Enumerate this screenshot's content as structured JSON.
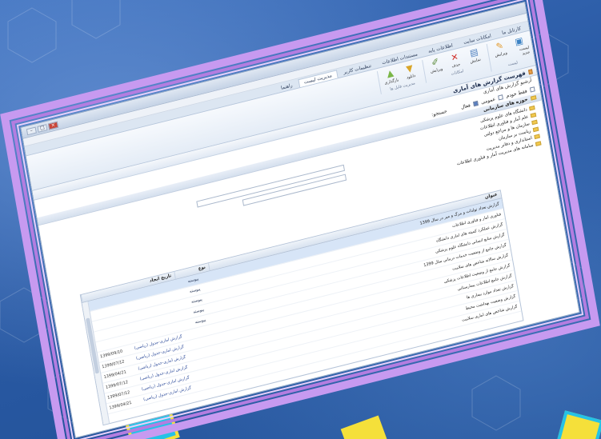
{
  "ribbon": {
    "tabs": [
      "کارتابل ما",
      "امکانات سایت",
      "اطلاعات پایه",
      "مستندات اطلاعات",
      "تنظیمات کاربر",
      "مدیریت لیست",
      "راهنما"
    ],
    "active_tab": "مدیریت لیست",
    "groups": [
      {
        "label": "لیست",
        "buttons": [
          "لیست جدید",
          "ویرایش"
        ]
      },
      {
        "label": "امکانات",
        "buttons": [
          "نمایش",
          "حذف",
          "ویرایش"
        ]
      },
      {
        "label": "مدیریت فایل ها",
        "buttons": [
          "دانلود",
          "بارگذاری"
        ]
      }
    ]
  },
  "panel": {
    "title": "فهرست گزارش های آماری",
    "breadcrumb": "آرشیو گزارش های آماری"
  },
  "filters": {
    "only_mine_label": "فقط خودم",
    "public_label": "عمومی",
    "active_label": "فعال",
    "search_label": "جستجو:"
  },
  "tree": {
    "root_label": "حوزه های سازمانی",
    "items": [
      "دانشگاه های علوم پزشکی",
      "علم آمار و فناوری اطلاعات",
      "سازمان ها و مراجع دولتی",
      "ریاست بر سازمان",
      "استانداری و دفاتر مدیریت",
      "سامانه های مدیریت آمار و فناوری اطلاعات"
    ]
  },
  "grid": {
    "columns": [
      "عنوان",
      "نوع",
      "تاریخ ایجاد"
    ],
    "rows": [
      {
        "title": "گزارش تعداد تولدات و مرگ و میر در سال 1399",
        "type": "پیوسته",
        "subtype": "",
        "date": ""
      },
      {
        "title": "فناوری آمار و فناوری اطلاعات",
        "type": "پیوسته",
        "subtype": "",
        "date": ""
      },
      {
        "title": "گزارش عملکرد کمیته های آماری دانشگاه",
        "type": "پیوسته",
        "subtype": "",
        "date": ""
      },
      {
        "title": "گزارش منابع انسانی دانشگاه علوم پزشکی",
        "type": "پیوسته",
        "subtype": "",
        "date": ""
      },
      {
        "title": "گزارش جامع از وضعیت خدمات درمانی سال 1399",
        "type": "پیوسته",
        "subtype": "",
        "date": ""
      },
      {
        "title": "گزارش سالانه شاخص های سلامت",
        "type": "",
        "subtype": "گزارش آماری-جدول (ریاضی)",
        "date": "1399/09/10"
      },
      {
        "title": "گزارش جامع از وضعیت اطلاعات پزشکی",
        "type": "",
        "subtype": "گزارش آماری-جدول (ریاضی)",
        "date": "1399/07/12"
      },
      {
        "title": "گزارش جامع اطلاعات بیمارستانی",
        "type": "",
        "subtype": "گزارش آماری-جدول (ریاضی)",
        "date": "1399/04/21"
      },
      {
        "title": "گزارش تعداد موارد بیماری ها",
        "type": "",
        "subtype": "گزارش آماری-جدول (ریاضی)",
        "date": "1399/07/12"
      },
      {
        "title": "گزارش وضعیت بهداشت محیط",
        "type": "",
        "subtype": "گزارش آماری-جدول (ریاضی)",
        "date": "1399/07/12"
      },
      {
        "title": "گزارش شاخص های آماری سلامت",
        "type": "",
        "subtype": "گزارش آماری-جدول (ریاضی)",
        "date": "1399/04/21"
      }
    ]
  },
  "colors": {
    "frame": "#c79af0",
    "background": "#2b5aa0"
  }
}
